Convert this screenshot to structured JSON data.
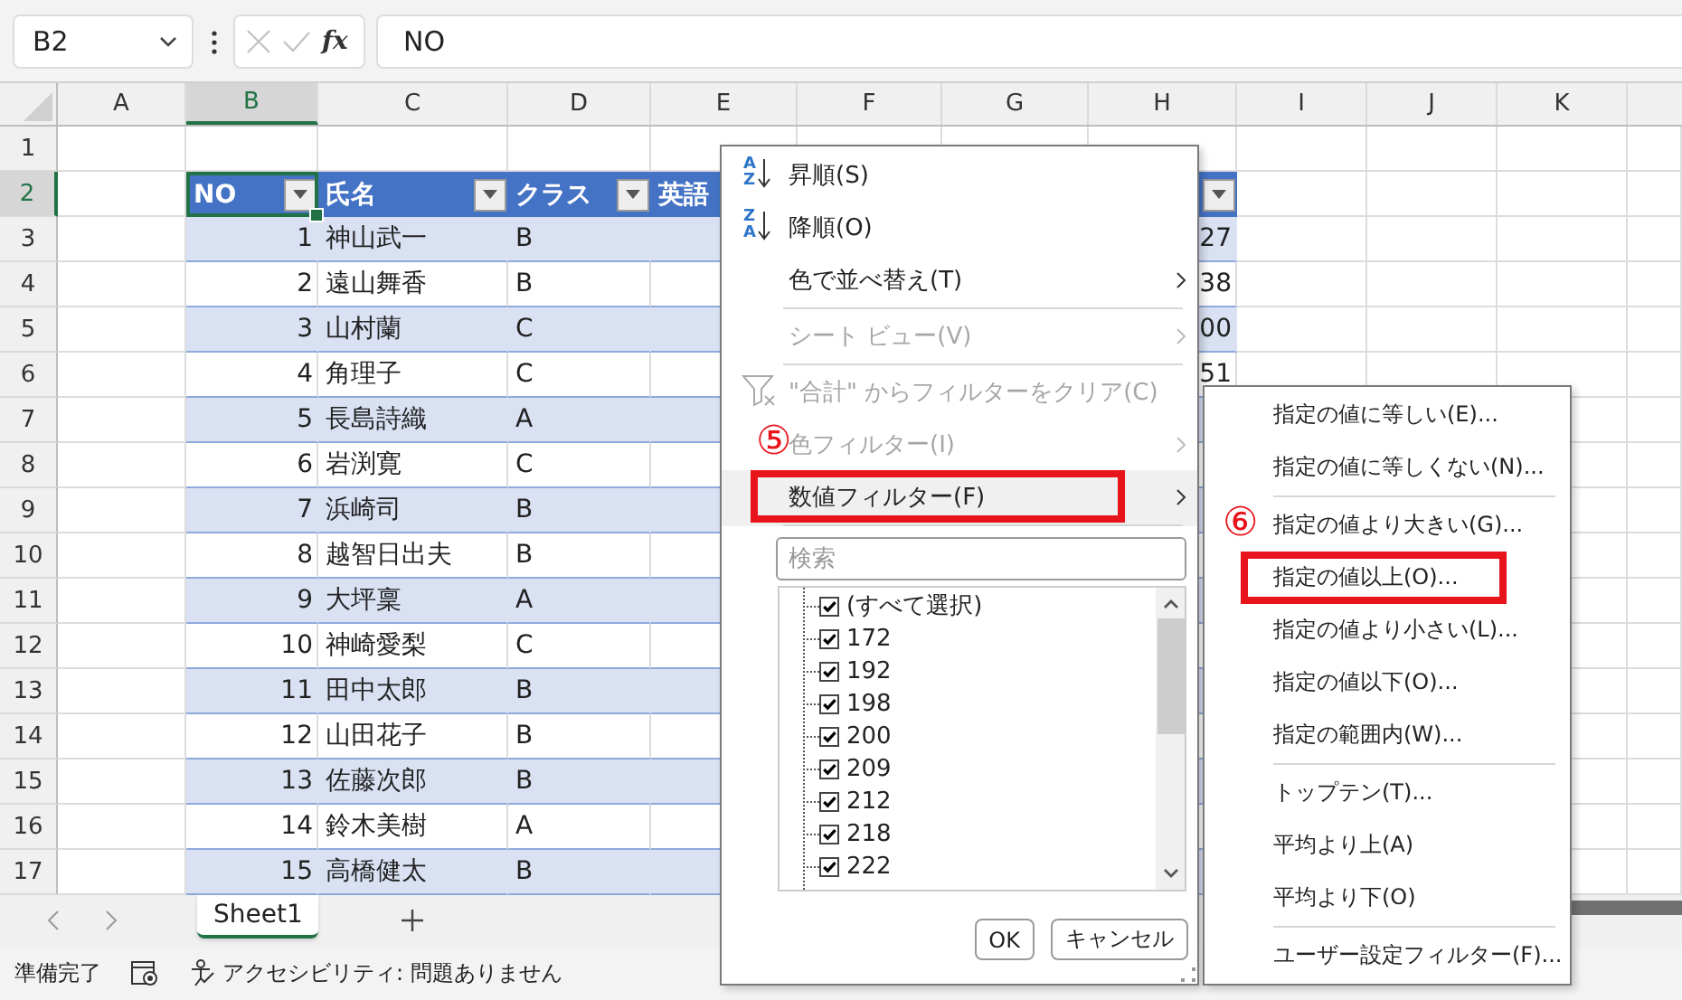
{
  "formula_bar": {
    "name_box": "B2",
    "function_label": "fx",
    "formula": "NO"
  },
  "columns": [
    {
      "label": "A",
      "selected": false
    },
    {
      "label": "B",
      "selected": true
    },
    {
      "label": "C",
      "selected": false
    },
    {
      "label": "D",
      "selected": false
    },
    {
      "label": "E",
      "selected": false
    },
    {
      "label": "F",
      "selected": false
    },
    {
      "label": "G",
      "selected": false
    },
    {
      "label": "H",
      "selected": false
    },
    {
      "label": "I",
      "selected": false
    },
    {
      "label": "J",
      "selected": false
    },
    {
      "label": "K",
      "selected": false
    }
  ],
  "row_headers": [
    {
      "label": "1",
      "selected": false
    },
    {
      "label": "2",
      "selected": true
    },
    {
      "label": "3",
      "selected": false
    },
    {
      "label": "4",
      "selected": false
    },
    {
      "label": "5",
      "selected": false
    },
    {
      "label": "6",
      "selected": false
    },
    {
      "label": "7",
      "selected": false
    },
    {
      "label": "8",
      "selected": false
    },
    {
      "label": "9",
      "selected": false
    },
    {
      "label": "10",
      "selected": false
    },
    {
      "label": "11",
      "selected": false
    },
    {
      "label": "12",
      "selected": false
    },
    {
      "label": "13",
      "selected": false
    },
    {
      "label": "14",
      "selected": false
    },
    {
      "label": "15",
      "selected": false
    },
    {
      "label": "16",
      "selected": false
    },
    {
      "label": "17",
      "selected": false
    }
  ],
  "table": {
    "headers": [
      {
        "label": "NO",
        "filter_button": true
      },
      {
        "label": "氏名",
        "filter_button": true
      },
      {
        "label": "クラス",
        "filter_button": true
      },
      {
        "label": "英語",
        "filter_button": false
      }
    ],
    "h_header": {
      "filter_button": true
    },
    "rows": [
      {
        "no": "1",
        "name": "神山武一",
        "class": "B",
        "column_h": "27"
      },
      {
        "no": "2",
        "name": "遠山舞香",
        "class": "B",
        "column_h": "38"
      },
      {
        "no": "3",
        "name": "山村蘭",
        "class": "C",
        "column_h": "00"
      },
      {
        "no": "4",
        "name": "角理子",
        "class": "C",
        "column_h": "51"
      },
      {
        "no": "5",
        "name": "長島詩織",
        "class": "A"
      },
      {
        "no": "6",
        "name": "岩渕寛",
        "class": "C"
      },
      {
        "no": "7",
        "name": "浜崎司",
        "class": "B"
      },
      {
        "no": "8",
        "name": "越智日出夫",
        "class": "B"
      },
      {
        "no": "9",
        "name": "大坪稟",
        "class": "A"
      },
      {
        "no": "10",
        "name": "神崎愛梨",
        "class": "C"
      },
      {
        "no": "11",
        "name": "田中太郎",
        "class": "B"
      },
      {
        "no": "12",
        "name": "山田花子",
        "class": "B"
      },
      {
        "no": "13",
        "name": "佐藤次郎",
        "class": "B"
      },
      {
        "no": "14",
        "name": "鈴木美樹",
        "class": "A"
      },
      {
        "no": "15",
        "name": "高橋健太",
        "class": "B"
      }
    ]
  },
  "sheet_tabs": [
    {
      "label": "Sheet1",
      "selected": true
    }
  ],
  "status_bar": {
    "mode": "準備完了",
    "accessibility": "アクセシビリティ: 問題ありません"
  },
  "filter_menu": {
    "items": [
      {
        "kind": "sort_asc",
        "icon_top": "A",
        "icon_bottom": "Z",
        "label": "昇順(S)",
        "disabled": false,
        "submenu": false,
        "separator": false,
        "hovered": false,
        "highlighted": false
      },
      {
        "kind": "sort_desc",
        "icon_top": "Z",
        "icon_bottom": "A",
        "label": "降順(O)",
        "disabled": false,
        "submenu": false,
        "separator": false,
        "hovered": false,
        "highlighted": false
      },
      {
        "kind": "command",
        "label": "色で並べ替え(T)",
        "disabled": false,
        "submenu": true,
        "separator": true,
        "hovered": false,
        "highlighted": false
      },
      {
        "kind": "command",
        "label": "シート ビュー(V)",
        "disabled": true,
        "submenu": true,
        "separator": true,
        "hovered": false,
        "highlighted": false
      },
      {
        "kind": "clear",
        "label": "\"合計\" からフィルターをクリア(C)",
        "disabled": true,
        "submenu": false,
        "separator": false,
        "hovered": false,
        "highlighted": false
      },
      {
        "kind": "command",
        "label": "色フィルター(I)",
        "disabled": true,
        "submenu": true,
        "separator": false,
        "hovered": false,
        "highlighted": false,
        "callout": "⑤"
      },
      {
        "kind": "command",
        "label": "数値フィルター(F)",
        "disabled": false,
        "submenu": true,
        "separator": true,
        "hovered": true,
        "highlighted": true
      }
    ],
    "search": {
      "placeholder": "検索"
    },
    "values": [
      {
        "label": "(すべて選択)",
        "checked": true
      },
      {
        "label": "172",
        "checked": true
      },
      {
        "label": "192",
        "checked": true
      },
      {
        "label": "198",
        "checked": true
      },
      {
        "label": "200",
        "checked": true
      },
      {
        "label": "209",
        "checked": true
      },
      {
        "label": "212",
        "checked": true
      },
      {
        "label": "218",
        "checked": true
      },
      {
        "label": "222",
        "checked": true
      }
    ],
    "buttons": [
      {
        "label": "OK"
      },
      {
        "label": "キャンセル"
      }
    ]
  },
  "number_filter_menu": {
    "items": [
      {
        "label": "指定の値に等しい(E)...",
        "separator": false,
        "highlighted": false
      },
      {
        "label": "指定の値に等しくない(N)...",
        "separator": true,
        "highlighted": false
      },
      {
        "label": "指定の値より大きい(G)...",
        "separator": false,
        "highlighted": false,
        "callout": "⑥"
      },
      {
        "label": "指定の値以上(O)...",
        "separator": false,
        "highlighted": true
      },
      {
        "label": "指定の値より小さい(L)...",
        "separator": false,
        "highlighted": false
      },
      {
        "label": "指定の値以下(O)...",
        "separator": false,
        "highlighted": false
      },
      {
        "label": "指定の範囲内(W)...",
        "separator": true,
        "highlighted": false
      },
      {
        "label": "トップテン(T)...",
        "separator": false,
        "highlighted": false
      },
      {
        "label": "平均より上(A)",
        "separator": false,
        "highlighted": false
      },
      {
        "label": "平均より下(O)",
        "separator": true,
        "highlighted": false
      },
      {
        "label": "ユーザー設定フィルター(F)...",
        "separator": false,
        "highlighted": false
      }
    ]
  }
}
